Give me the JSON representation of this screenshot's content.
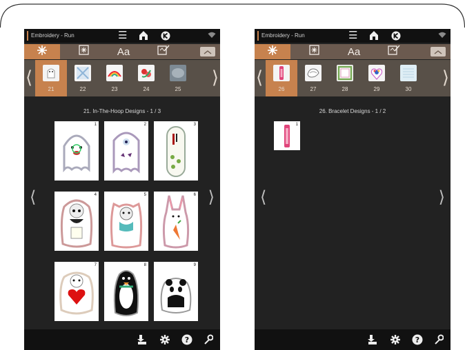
{
  "left_screen": {
    "app_title": "Embroidery - Run",
    "toolbar": {
      "tab_text_label": "Aa"
    },
    "categories": [
      {
        "number": "21",
        "selected": true
      },
      {
        "number": "22",
        "selected": false
      },
      {
        "number": "23",
        "selected": false
      },
      {
        "number": "24",
        "selected": false
      },
      {
        "number": "25",
        "selected": false
      }
    ],
    "section_title": "21. In-The-Hoop Designs  - 1 / 3",
    "designs": [
      "1",
      "2",
      "3",
      "4",
      "5",
      "6",
      "7",
      "8",
      "9"
    ]
  },
  "right_screen": {
    "app_title": "Embroidery - Run",
    "toolbar": {
      "tab_text_label": "Aa"
    },
    "categories": [
      {
        "number": "26",
        "selected": true
      },
      {
        "number": "27",
        "selected": false
      },
      {
        "number": "28",
        "selected": false
      },
      {
        "number": "29",
        "selected": false
      },
      {
        "number": "30",
        "selected": false
      }
    ],
    "section_title": "26. Bracelet Designs  - 1 / 2",
    "designs": [
      "1"
    ]
  },
  "icons": {
    "statusbar": [
      "menu-icon",
      "home-icon",
      "k-logo-icon",
      "wifi-icon"
    ],
    "toolbar": [
      "stitch-tab-icon",
      "design-tab-icon",
      "text-tab-icon",
      "edit-tab-icon",
      "collapse-icon"
    ],
    "bottombar": [
      "import-icon",
      "settings-icon",
      "help-icon",
      "tools-icon"
    ]
  },
  "colors": {
    "accent": "#c7824e",
    "toolbar_bg": "#6b5a4f",
    "strip_bg": "#585048",
    "screen_bg": "#222222",
    "bar_bg": "#111111"
  }
}
